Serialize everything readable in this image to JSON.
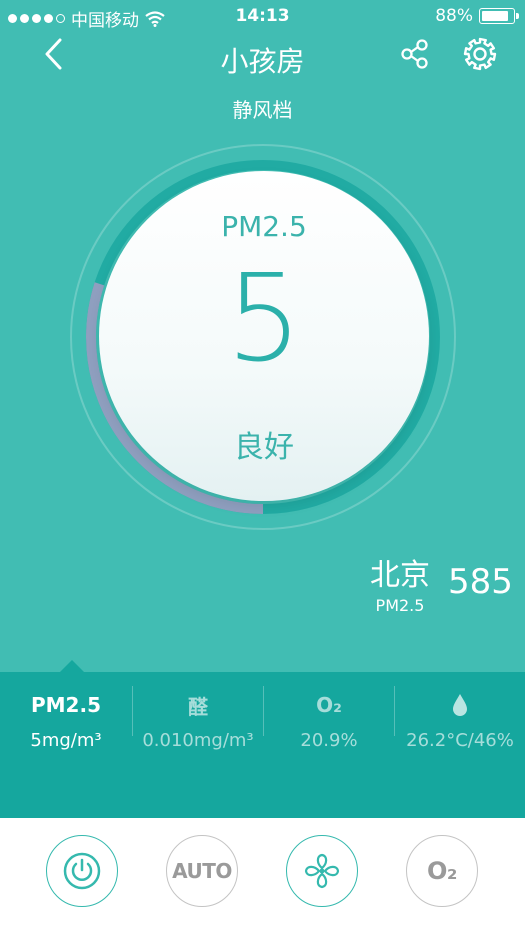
{
  "status_bar": {
    "carrier": "中国移动",
    "time": "14:13",
    "battery_percent": "88%",
    "battery_level": 0.88,
    "signal_dots_filled": 4,
    "signal_dots_total": 5
  },
  "nav": {
    "title": "小孩房",
    "back_icon": "chevron-left-icon",
    "share_icon": "share-icon",
    "settings_icon": "gear-icon"
  },
  "mode": "静风档",
  "gauge": {
    "label": "PM2.5",
    "value": "5",
    "quality": "良好",
    "progress_fraction": 0.3
  },
  "outdoor": {
    "city": "北京",
    "metric": "PM2.5",
    "value": "585"
  },
  "metrics": [
    {
      "icon": "pm25-icon",
      "label": "PM2.5",
      "value": "5mg/m³",
      "active": true
    },
    {
      "icon": "formaldehyde-icon",
      "label": "醛",
      "value": "0.010mg/m³",
      "active": false
    },
    {
      "icon": "oxygen-icon",
      "label": "O₂",
      "value": "20.9%",
      "active": false
    },
    {
      "icon": "humidity-drop-icon",
      "label": "",
      "value": "26.2°C/46%",
      "active": false
    }
  ],
  "controls": [
    {
      "icon": "power-icon",
      "label": "",
      "active": true
    },
    {
      "icon": "auto-mode-icon",
      "label": "AUTO",
      "active": false
    },
    {
      "icon": "fan-icon",
      "label": "",
      "active": true
    },
    {
      "icon": "oxygen-mode-icon",
      "label": "O₂",
      "active": false
    }
  ],
  "colors": {
    "background": "#41bdb3",
    "metrics_bar": "#15a79e",
    "accent_teal": "#2bb0aa",
    "progress_arc": "#8f9fbf",
    "inactive_gray": "#9a9a9a"
  }
}
